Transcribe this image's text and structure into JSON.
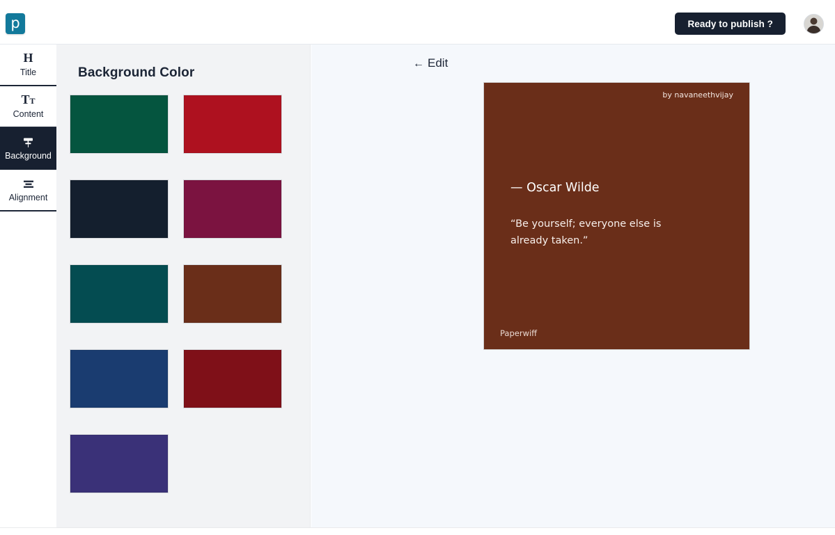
{
  "header": {
    "logo_letter": "p",
    "logo_color": "#12799b",
    "publish_label": "Ready to publish ?",
    "publish_bg": "#172030",
    "avatar_name": "user-avatar"
  },
  "sidebar": {
    "items": [
      {
        "icon": "heading-icon",
        "glyph": "H",
        "label": "Title",
        "active": false
      },
      {
        "icon": "text-size-icon",
        "glyph": "Tt",
        "label": "Content",
        "active": false
      },
      {
        "icon": "paint-roller-icon",
        "glyph": "",
        "label": "Background",
        "active": true
      },
      {
        "icon": "align-center-icon",
        "glyph": "",
        "label": "Alignment",
        "active": false
      }
    ]
  },
  "panel": {
    "title": "Background Color",
    "swatches": [
      {
        "name": "swatch-dark-green",
        "color": "#05553f"
      },
      {
        "name": "swatch-crimson",
        "color": "#ae111f"
      },
      {
        "name": "swatch-midnight-navy",
        "color": "#141f2e"
      },
      {
        "name": "swatch-wine",
        "color": "#7b1340"
      },
      {
        "name": "swatch-teal",
        "color": "#044c51"
      },
      {
        "name": "swatch-brown",
        "color": "#6a2e19"
      },
      {
        "name": "swatch-royal-blue",
        "color": "#1a3c70"
      },
      {
        "name": "swatch-dark-red",
        "color": "#7f1018"
      },
      {
        "name": "swatch-purple",
        "color": "#3a3178"
      }
    ]
  },
  "preview": {
    "edit_label": "Edit",
    "edit_arrow": "←",
    "card": {
      "background": "#6a2e19",
      "author": "by navaneethvijay",
      "title": "— Oscar Wilde",
      "quote": "“Be yourself; everyone else is already taken.”",
      "brand": "Paperwiff"
    }
  }
}
